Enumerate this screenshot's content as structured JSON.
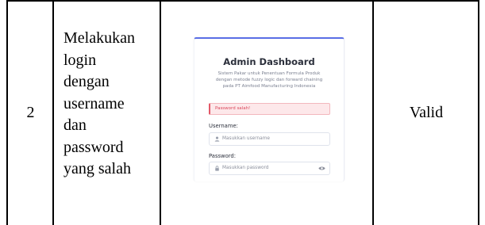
{
  "row": {
    "number": "2",
    "description_lines": [
      "Melakukan",
      "login",
      "dengan",
      "username",
      "dan",
      "password",
      "yang salah"
    ],
    "result": "Valid"
  },
  "screenshot": {
    "title": "Admin Dashboard",
    "subtitle_lines": [
      "Sistem Pakar untuk Penentuan Formula Produk",
      "dengan metode fuzzy logic dan forward chaining",
      "pada PT Aimfood Manufacturing Indonesia"
    ],
    "alert_text": "Password salah!",
    "username": {
      "label": "Username:",
      "placeholder": "Masukkan username",
      "icon": "user-icon"
    },
    "password": {
      "label": "Password:",
      "placeholder": "Masukkan password",
      "icon": "lock-icon",
      "toggle_icon": "eye-icon"
    },
    "colors": {
      "accent": "#5a6ee6",
      "alert_bg": "#fde8ea",
      "alert_text": "#d9475a"
    }
  }
}
